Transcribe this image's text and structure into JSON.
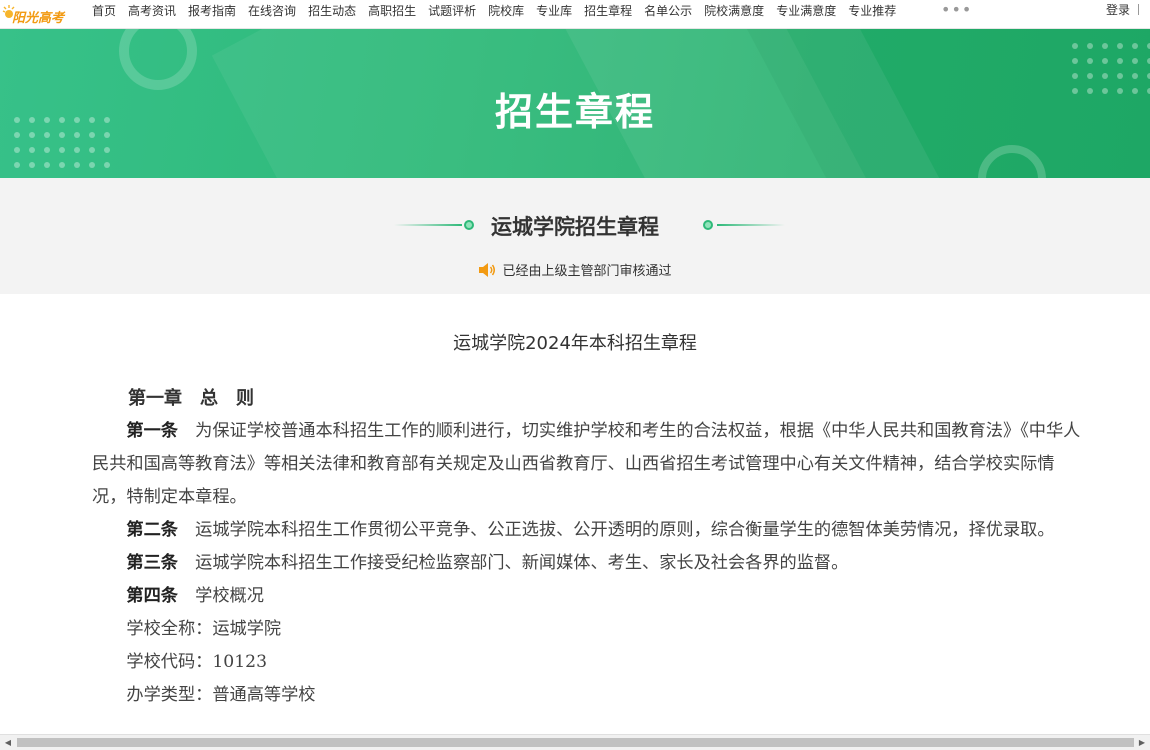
{
  "brand": {
    "logo_text": "阳光高考",
    "accent": "#2eb979",
    "logo_color": "#f29a12"
  },
  "nav": {
    "items": [
      "首页",
      "高考资讯",
      "报考指南",
      "在线咨询",
      "招生动态",
      "高职招生",
      "试题评析",
      "院校库",
      "专业库",
      "招生章程",
      "名单公示",
      "院校满意度",
      "专业满意度",
      "专业推荐"
    ],
    "more": "•••",
    "login": "登录"
  },
  "banner": {
    "title": "招生章程"
  },
  "subheader": {
    "title": "运城学院招生章程",
    "approval": "已经由上级主管部门审核通过",
    "speaker_icon": "speaker-icon"
  },
  "document": {
    "title": "运城学院2024年本科招生章程",
    "chapter1": "第一章　总　则",
    "art1_label": "第一条",
    "art1_text": "为保证学校普通本科招生工作的顺利进行，切实维护学校和考生的合法权益，根据《中华人民共和国教育法》《中华人民共和国高等教育法》等相关法律和教育部有关规定及山西省教育厅、山西省招生考试管理中心有关文件精神，结合学校实际情况，特制定本章程。",
    "art2_label": "第二条",
    "art2_text": "运城学院本科招生工作贯彻公平竞争、公正选拔、公开透明的原则，综合衡量学生的德智体美劳情况，择优录取。",
    "art3_label": "第三条",
    "art3_text": "运城学院本科招生工作接受纪检监察部门、新闻媒体、考生、家长及社会各界的监督。",
    "art4_label": "第四条",
    "art4_text": "学校概况",
    "line_fullname": "学校全称：运城学院",
    "line_code": "学校代码：10123",
    "line_type": "办学类型：普通高等学校"
  }
}
